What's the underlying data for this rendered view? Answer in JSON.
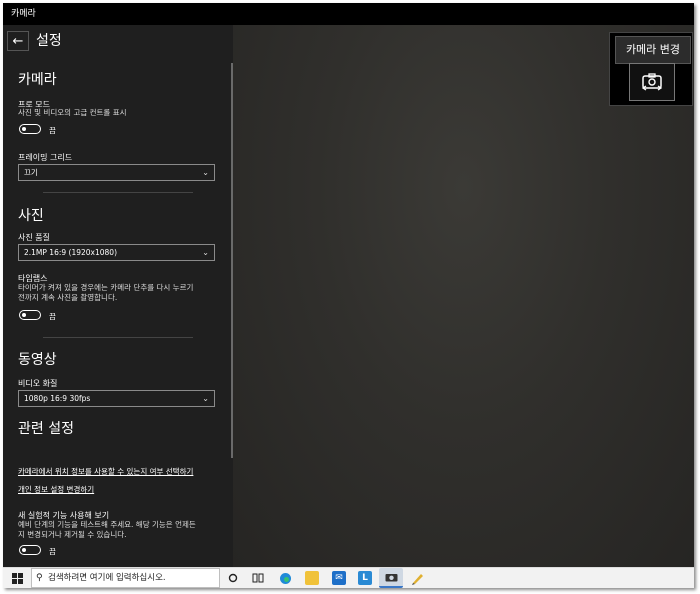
{
  "window": {
    "title": "카메라"
  },
  "settings": {
    "back_icon": "arrow-left-icon",
    "title": "설정",
    "camera": {
      "heading": "카메라",
      "pro_mode": {
        "label": "프로 모드",
        "description": "사진 및 비디오의 고급 컨트롤 표시",
        "state": "끔"
      },
      "framing_grid": {
        "label": "프레이밍 그리드",
        "value": "끄기"
      }
    },
    "photo": {
      "heading": "사진",
      "quality": {
        "label": "사진 품질",
        "value": "2.1MP 16:9 (1920x1080)"
      },
      "timelapse": {
        "label": "타임랩스",
        "description_line1": "타이머가 켜져 있을 경우에는 카메라 단추를 다시 누르기",
        "description_line2": "전까지 계속 사진을 촬영합니다.",
        "state": "끔"
      }
    },
    "video": {
      "heading": "동영상",
      "quality": {
        "label": "비디오 화질",
        "value": "1080p 16:9 30fps"
      }
    },
    "related": {
      "heading": "관련 설정",
      "location_link": "카메라에서 위치 정보를 사용할 수 있는지 여부 선택하기",
      "privacy_link": "개인 정보 설정 변경하기"
    },
    "experimental": {
      "label": "새 실험적 기능 사용해 보기",
      "description_line1": "예비 단계의 기능을 테스트해 주세요. 해당 기능은 언제든",
      "description_line2": "지 변경되거나 제거될 수 있습니다.",
      "state": "끔"
    }
  },
  "switch_camera": {
    "tooltip": "카메라 변경",
    "icon": "camera-switch-icon"
  },
  "taskbar": {
    "search_placeholder": "검색하려면 여기에 입력하십시오.",
    "icons": [
      "windows-start-icon",
      "search-icon",
      "cortana-icon",
      "task-view-icon",
      "edge-icon",
      "file-explorer-icon",
      "mail-icon",
      "l-app-icon",
      "camera-icon",
      "paint-icon"
    ]
  }
}
